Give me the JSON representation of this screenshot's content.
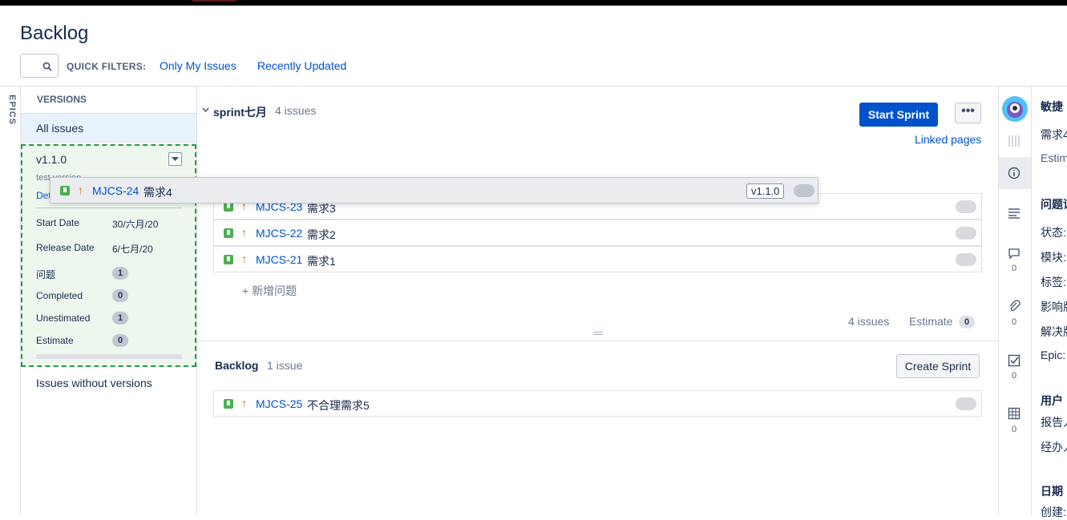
{
  "page": {
    "title": "Backlog"
  },
  "filters": {
    "label": "QUICK FILTERS:",
    "items": [
      "Only My Issues",
      "Recently Updated"
    ]
  },
  "sidebar": {
    "epics_label": "EPICS",
    "versions_label": "VERSIONS",
    "all_issues": "All issues",
    "version": {
      "name": "v1.1.0",
      "description": "test version",
      "details_link": "Det",
      "start_date_label": "Start Date",
      "start_date": "30/六月/20",
      "release_date_label": "Release Date",
      "release_date": "6/七月/20",
      "issues_label": "问题",
      "issues": "1",
      "completed_label": "Completed",
      "completed": "0",
      "unestimated_label": "Unestimated",
      "unestimated": "1",
      "estimate_label": "Estimate",
      "estimate": "0"
    },
    "without_versions": "Issues without versions"
  },
  "sprint": {
    "name": "sprint七月",
    "count": "4 issues",
    "start_button": "Start Sprint",
    "more_button": "•••",
    "linked_pages": "Linked pages",
    "issues": [
      {
        "key": "MJCS-23",
        "summary": "需求3"
      },
      {
        "key": "MJCS-22",
        "summary": "需求2"
      },
      {
        "key": "MJCS-21",
        "summary": "需求1"
      }
    ],
    "add_issue": "+ 新增问题",
    "footer_count": "4 issues",
    "footer_estimate_label": "Estimate",
    "footer_estimate": "0"
  },
  "dragging": {
    "key": "MJCS-24",
    "summary": "需求4",
    "version": "v1.1.0"
  },
  "backlog": {
    "name": "Backlog",
    "count": "1 issue",
    "create_button": "Create Sprint",
    "issues": [
      {
        "key": "MJCS-25",
        "summary": "不合理需求5"
      }
    ]
  },
  "rail": {
    "counts": [
      "0",
      "0",
      "0",
      "0"
    ]
  },
  "detail": {
    "project": "敏捷",
    "summary": "需求4",
    "estimate": "Estim",
    "section_details": "问题详",
    "fields": [
      "状态:",
      "模块:",
      "标签:",
      "影响版",
      "解决版",
      "Epic:"
    ],
    "section_people": "用户",
    "people": [
      "报告人",
      "经办人"
    ],
    "section_dates": "日期",
    "dates": [
      "创建:"
    ]
  },
  "colors": {
    "accent": "#0052cc",
    "story": "#4caf50",
    "priority": "#e0661b",
    "drop_zone": "#1f9d3a"
  }
}
